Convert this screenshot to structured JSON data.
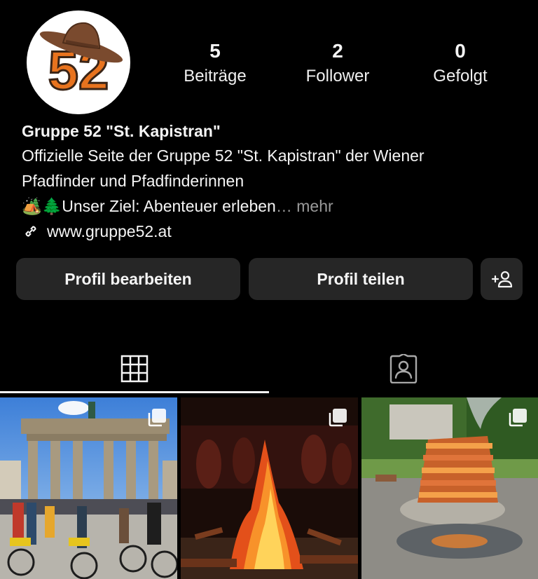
{
  "profile": {
    "avatar_logo_text": "52",
    "name": "Gruppe 52 \"St. Kapistran\"",
    "bio_line1": "Offizielle Seite der Gruppe 52 \"St. Kapistran\" der Wiener",
    "bio_line2": "Pfadfinder und Pfadfinderinnen",
    "bio_line3_emoji": "🏕️🌲",
    "bio_line3_text": "Unser Ziel: Abenteuer erleben",
    "bio_more": "… mehr",
    "website": "www.gruppe52.at"
  },
  "stats": [
    {
      "value": "5",
      "label": "Beiträge"
    },
    {
      "value": "2",
      "label": "Follower"
    },
    {
      "value": "0",
      "label": "Gefolgt"
    }
  ],
  "actions": {
    "edit_label": "Profil bearbeiten",
    "share_label": "Profil teilen",
    "add_person_icon": "add-person-icon"
  },
  "tabs": [
    {
      "icon": "grid-icon",
      "active": true
    },
    {
      "icon": "tagged-icon",
      "active": false
    }
  ],
  "posts": [
    {
      "subject": "Brandenburger Tor mit Fahrradgruppe",
      "icon": "multiple-posts-icon"
    },
    {
      "subject": "Lagerfeuer bei Nacht",
      "icon": "multiple-posts-icon"
    },
    {
      "subject": "Holzstoß-Feuer im Garten",
      "icon": "multiple-posts-icon"
    }
  ],
  "colors": {
    "background": "#000000",
    "button": "#262626",
    "text": "#f5f5f5",
    "muted": "#9a9a9a",
    "logo_orange": "#e8731e",
    "hat_brown": "#7a4a2e"
  }
}
